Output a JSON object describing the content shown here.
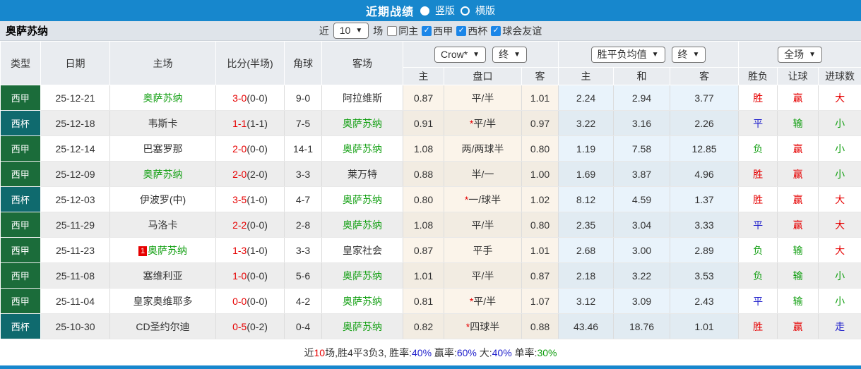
{
  "titlebar": {
    "title": "近期战绩",
    "layout_options": [
      {
        "label": "竖版",
        "selected": true
      },
      {
        "label": "横版",
        "selected": false
      }
    ]
  },
  "filterbar": {
    "team": "奥萨苏纳",
    "near_label": "近",
    "match_count": "10",
    "games_label": "场",
    "filters": [
      {
        "label": "同主",
        "checked": false
      },
      {
        "label": "西甲",
        "checked": true
      },
      {
        "label": "西杯",
        "checked": true
      },
      {
        "label": "球会友谊",
        "checked": true
      }
    ]
  },
  "table": {
    "headers": {
      "type": "类型",
      "date": "日期",
      "home": "主场",
      "score": "比分(半场)",
      "corners": "角球",
      "away": "客场",
      "host": "主",
      "handicap": "盘口",
      "guest": "客",
      "mean_host": "主",
      "mean_draw": "和",
      "mean_guest": "客",
      "result": "胜负",
      "handicap_result": "让球",
      "goals": "进球数"
    },
    "selects": {
      "company": "Crow*",
      "company_state": "终",
      "mean": "胜平负均值",
      "mean_state": "终",
      "scope": "全场"
    },
    "rows": [
      {
        "type": "西甲",
        "date": "25-12-21",
        "home": {
          "name": "奥萨苏纳",
          "green": true
        },
        "score": {
          "full": "3-0",
          "half": "(0-0)"
        },
        "corners": "9-0",
        "away": {
          "name": "阿拉维斯",
          "green": false
        },
        "odds": {
          "home": "0.87",
          "star": false,
          "handicap": "平/半",
          "away": "1.01"
        },
        "mean": {
          "win": "2.24",
          "draw": "2.94",
          "lose": "3.77"
        },
        "result": "胜",
        "handicap_result": "赢",
        "goals": "大"
      },
      {
        "type": "西杯",
        "date": "25-12-18",
        "home": {
          "name": "韦斯卡",
          "green": false
        },
        "score": {
          "full": "1-1",
          "half": "(1-1)"
        },
        "corners": "7-5",
        "away": {
          "name": "奥萨苏纳",
          "green": true
        },
        "odds": {
          "home": "0.91",
          "star": true,
          "handicap": "平/半",
          "away": "0.97"
        },
        "mean": {
          "win": "3.22",
          "draw": "3.16",
          "lose": "2.26"
        },
        "result": "平",
        "handicap_result": "输",
        "goals": "小"
      },
      {
        "type": "西甲",
        "date": "25-12-14",
        "home": {
          "name": "巴塞罗那",
          "green": false
        },
        "score": {
          "full": "2-0",
          "half": "(0-0)"
        },
        "corners": "14-1",
        "away": {
          "name": "奥萨苏纳",
          "green": true
        },
        "odds": {
          "home": "1.08",
          "star": false,
          "handicap": "两/两球半",
          "away": "0.80"
        },
        "mean": {
          "win": "1.19",
          "draw": "7.58",
          "lose": "12.85"
        },
        "result": "负",
        "handicap_result": "赢",
        "goals": "小"
      },
      {
        "type": "西甲",
        "date": "25-12-09",
        "home": {
          "name": "奥萨苏纳",
          "green": true
        },
        "score": {
          "full": "2-0",
          "half": "(2-0)"
        },
        "corners": "3-3",
        "away": {
          "name": "莱万特",
          "green": false
        },
        "odds": {
          "home": "0.88",
          "star": false,
          "handicap": "半/一",
          "away": "1.00"
        },
        "mean": {
          "win": "1.69",
          "draw": "3.87",
          "lose": "4.96"
        },
        "result": "胜",
        "handicap_result": "赢",
        "goals": "小"
      },
      {
        "type": "西杯",
        "date": "25-12-03",
        "home": {
          "name": "伊波罗(中)",
          "green": false
        },
        "score": {
          "full": "3-5",
          "half": "(1-0)"
        },
        "corners": "4-7",
        "away": {
          "name": "奥萨苏纳",
          "green": true
        },
        "odds": {
          "home": "0.80",
          "star": true,
          "handicap": "一/球半",
          "away": "1.02"
        },
        "mean": {
          "win": "8.12",
          "draw": "4.59",
          "lose": "1.37"
        },
        "result": "胜",
        "handicap_result": "赢",
        "goals": "大"
      },
      {
        "type": "西甲",
        "date": "25-11-29",
        "home": {
          "name": "马洛卡",
          "green": false
        },
        "score": {
          "full": "2-2",
          "half": "(0-0)"
        },
        "corners": "2-8",
        "away": {
          "name": "奥萨苏纳",
          "green": true
        },
        "odds": {
          "home": "1.08",
          "star": false,
          "handicap": "平/半",
          "away": "0.80"
        },
        "mean": {
          "win": "2.35",
          "draw": "3.04",
          "lose": "3.33"
        },
        "result": "平",
        "handicap_result": "赢",
        "goals": "大"
      },
      {
        "type": "西甲",
        "date": "25-11-23",
        "home": {
          "name": "奥萨苏纳",
          "green": true,
          "red_card": "1"
        },
        "score": {
          "full": "1-3",
          "half": "(1-0)"
        },
        "corners": "3-3",
        "away": {
          "name": "皇家社会",
          "green": false
        },
        "odds": {
          "home": "0.87",
          "star": false,
          "handicap": "平手",
          "away": "1.01"
        },
        "mean": {
          "win": "2.68",
          "draw": "3.00",
          "lose": "2.89"
        },
        "result": "负",
        "handicap_result": "输",
        "goals": "大"
      },
      {
        "type": "西甲",
        "date": "25-11-08",
        "home": {
          "name": "塞维利亚",
          "green": false
        },
        "score": {
          "full": "1-0",
          "half": "(0-0)"
        },
        "corners": "5-6",
        "away": {
          "name": "奥萨苏纳",
          "green": true
        },
        "odds": {
          "home": "1.01",
          "star": false,
          "handicap": "平/半",
          "away": "0.87"
        },
        "mean": {
          "win": "2.18",
          "draw": "3.22",
          "lose": "3.53"
        },
        "result": "负",
        "handicap_result": "输",
        "goals": "小"
      },
      {
        "type": "西甲",
        "date": "25-11-04",
        "home": {
          "name": "皇家奥维耶多",
          "green": false
        },
        "score": {
          "full": "0-0",
          "half": "(0-0)"
        },
        "corners": "4-2",
        "away": {
          "name": "奥萨苏纳",
          "green": true
        },
        "odds": {
          "home": "0.81",
          "star": true,
          "handicap": "平/半",
          "away": "1.07"
        },
        "mean": {
          "win": "3.12",
          "draw": "3.09",
          "lose": "2.43"
        },
        "result": "平",
        "handicap_result": "输",
        "goals": "小"
      },
      {
        "type": "西杯",
        "date": "25-10-30",
        "home": {
          "name": "CD圣约尔迪",
          "green": false
        },
        "score": {
          "full": "0-5",
          "half": "(0-2)"
        },
        "corners": "0-4",
        "away": {
          "name": "奥萨苏纳",
          "green": true
        },
        "odds": {
          "home": "0.82",
          "star": true,
          "handicap": "四球半",
          "away": "0.88"
        },
        "mean": {
          "win": "43.46",
          "draw": "18.76",
          "lose": "1.01"
        },
        "result": "胜",
        "handicap_result": "赢",
        "goals": "走"
      }
    ]
  },
  "footer": {
    "segments": [
      {
        "text": "近",
        "color": "dark"
      },
      {
        "text": "10",
        "color": "red"
      },
      {
        "text": "场,胜4平3负3, 胜率:",
        "color": "dark"
      },
      {
        "text": "40%",
        "color": "blue"
      },
      {
        "text": " 赢率:",
        "color": "dark"
      },
      {
        "text": "60%",
        "color": "blue"
      },
      {
        "text": " 大:",
        "color": "dark"
      },
      {
        "text": "40%",
        "color": "blue"
      },
      {
        "text": " 单率:",
        "color": "dark"
      },
      {
        "text": "30%",
        "color": "green"
      }
    ]
  },
  "colors": {
    "topbar": "#1787cd",
    "badge": {
      "西甲": "#1b6c3a",
      "西杯": "#0f6a6e"
    },
    "team_green": "#0f9e0f",
    "accent_red": "#e60000",
    "checkbox_blue": "#1b86e8",
    "outcome": {
      "胜": "#e60000",
      "平": "#2222cc",
      "负": "#0f9e0f",
      "赢": "#e60000",
      "输": "#0f9e0f",
      "走": "#2222cc",
      "大": "#e60000",
      "小": "#0f9e0f"
    },
    "text": {
      "dark": "#333333",
      "red": "#e60000",
      "blue": "#2222cc",
      "green": "#0f9e0f"
    }
  }
}
